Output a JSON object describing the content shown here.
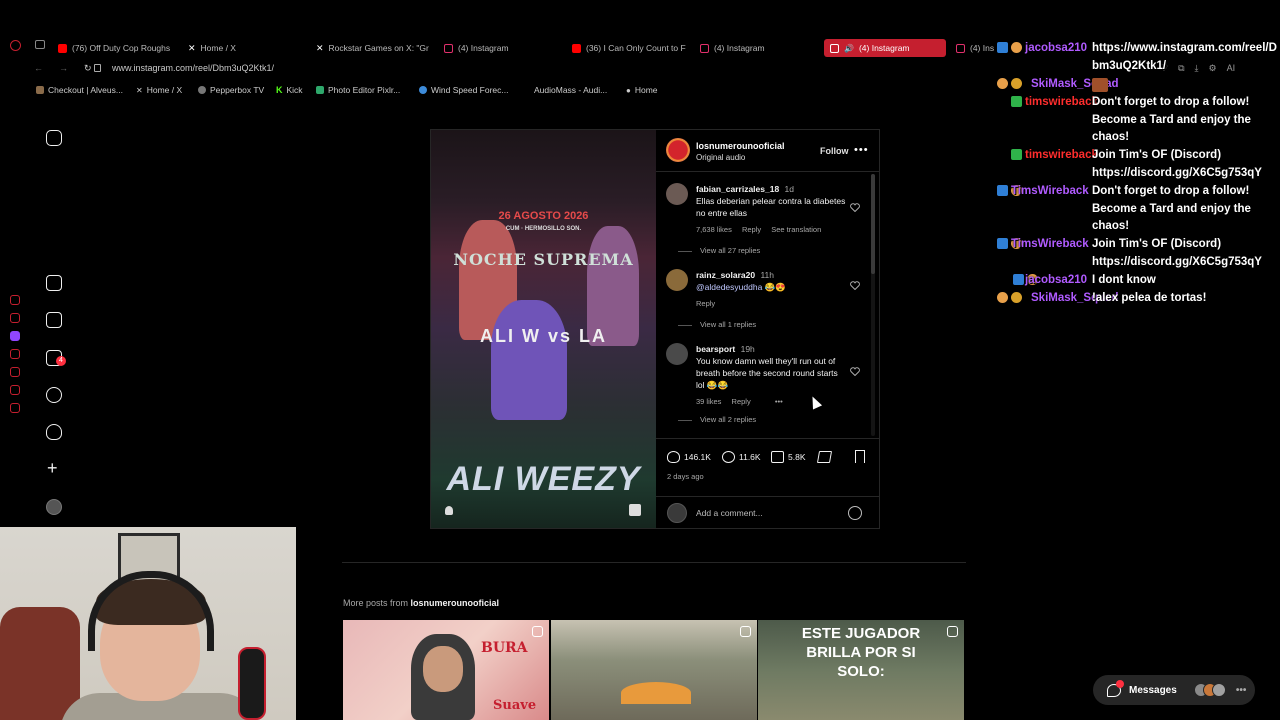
{
  "browser": {
    "tabs": [
      {
        "label": "(76) Off Duty Cop Roughs",
        "icon": "youtube-icon",
        "color": "#ff0000"
      },
      {
        "label": "Home / X",
        "icon": "x-icon",
        "color": "#ffffff"
      },
      {
        "label": "Rockstar Games on X: \"Gr",
        "icon": "x-icon",
        "color": "#ffffff"
      },
      {
        "label": "(4) Instagram",
        "icon": "instagram-icon",
        "color": "#e1306c"
      },
      {
        "label": "(36) I Can Only Count to F",
        "icon": "youtube-icon",
        "color": "#ff0000"
      },
      {
        "label": "(4) Instagram",
        "icon": "instagram-icon",
        "color": "#e1306c"
      },
      {
        "label": "(4) Instagram",
        "icon": "instagram-icon",
        "color": "#e1306c",
        "active": true
      },
      {
        "label": "(4) Ins",
        "icon": "instagram-icon",
        "color": "#e1306c"
      }
    ],
    "url": "www.instagram.com/reel/Dbm3uQ2Ktk1/",
    "bookmarks": [
      {
        "label": "Checkout | Alveus...",
        "icon": "bookmark-icon"
      },
      {
        "label": "Home / X",
        "icon": "x-icon"
      },
      {
        "label": "Pepperbox TV",
        "icon": "bookmark-icon"
      },
      {
        "label": "Kick",
        "icon": "kick-icon"
      },
      {
        "label": "Photo Editor Pixlr...",
        "icon": "bookmark-icon"
      },
      {
        "label": "Wind Speed Forec...",
        "icon": "bookmark-icon"
      },
      {
        "label": "AudioMass - Audi...",
        "icon": "bookmark-icon"
      },
      {
        "label": "Home",
        "icon": "location-icon"
      }
    ],
    "accent_color": "#c51f2f"
  },
  "sidebar": {
    "notification_count": "4"
  },
  "post": {
    "username": "losnumerounooficial",
    "audio": "Original audio",
    "follow_label": "Follow",
    "more_label": "•••",
    "media": {
      "date_text": "26 AGOSTO 2026",
      "sub_text": "CUM · HERMOSILLO SON.",
      "event_title": "NOCHE SUPREMA",
      "vs_text": "ALI W  vs  LA",
      "name_text": "ALI WEEZY"
    },
    "comments": [
      {
        "user": "fabian_carrizales_18",
        "time": "1d",
        "text": "Ellas deberian pelear contra la diabetes no entre ellas",
        "likes": "7,638 likes",
        "reply": "Reply",
        "translation": "See translation",
        "replies": "View all 27 replies"
      },
      {
        "user": "rainz_solara20",
        "time": "11h",
        "mention": "@aldedesyuddha",
        "text": "😂😍",
        "reply": "Reply",
        "replies": "View all 1 replies"
      },
      {
        "user": "bearsport",
        "time": "19h",
        "text": "You know damn well they'll run out of breath before the second round starts lol 😂😂",
        "likes": "39 likes",
        "reply": "Reply",
        "more": "•••",
        "replies": "View all 2 replies"
      }
    ],
    "actions": {
      "likes": "146.1K",
      "comments": "11.6K",
      "reposts": "5.8K"
    },
    "date": "2 days ago",
    "comment_placeholder": "Add a comment..."
  },
  "more_posts": {
    "prefix": "More posts from",
    "username": "losnumerounooficial",
    "thumbs": [
      {
        "brand": "BURA",
        "label": "Suave"
      },
      {
        "label": ""
      },
      {
        "text": "ESTE JUGADOR BRILLA POR SI SOLO:"
      }
    ]
  },
  "chat": [
    {
      "user": "jacobsa210",
      "user_color": "#b05bff",
      "text": "https://www.instagram.com/reel/Dbm3uQ2Ktk1/"
    },
    {
      "user": "SkiMask_Squad",
      "user_color": "#b05bff",
      "text": ""
    },
    {
      "user": "timswireback",
      "user_color": "#ff2d2d",
      "text": "Don't forget to drop a follow! Become a Tard and enjoy the chaos!"
    },
    {
      "user": "timswireback",
      "user_color": "#ff2d2d",
      "text": "Join Tim's OF (Discord) https://discord.gg/X6C5g753qY"
    },
    {
      "user": "TimsWireback",
      "user_color": "#b05bff",
      "text": "Don't forget to drop a follow! Become a Tard and enjoy the chaos!"
    },
    {
      "user": "TimsWireback",
      "user_color": "#b05bff",
      "text": "Join Tim's OF (Discord) https://discord.gg/X6C5g753qY"
    },
    {
      "user": "jacobsa210",
      "user_color": "#b05bff",
      "text": "I dont know"
    },
    {
      "user": "SkiMask_Squad",
      "user_color": "#b05bff",
      "text": "!alex pelea de tortas!"
    }
  ],
  "messages": {
    "label": "Messages"
  }
}
